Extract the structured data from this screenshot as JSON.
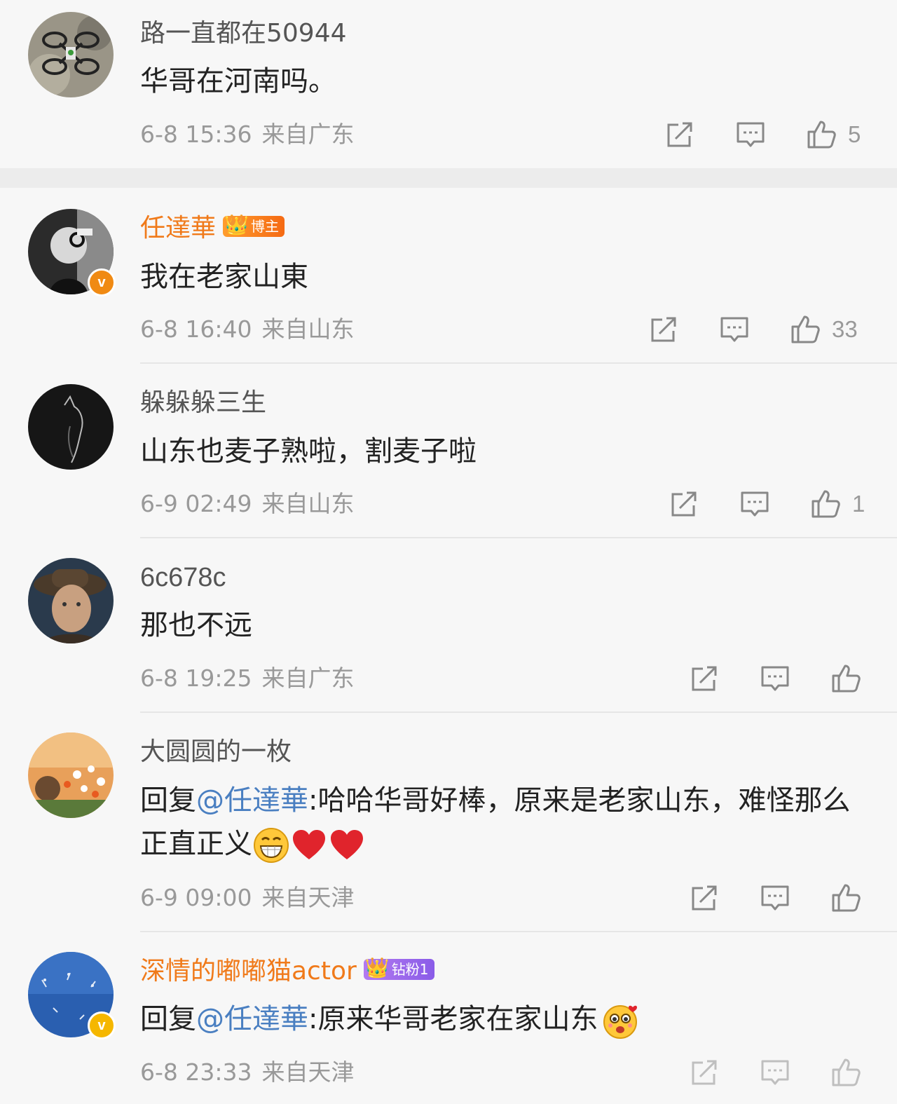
{
  "comments": [
    {
      "user": "路一直都在50944",
      "text": "华哥在河南吗。",
      "date": "6-8 15:36",
      "location": "来自广东",
      "likes": "5"
    },
    {
      "user": "任達華",
      "badge": "博主",
      "text": "我在老家山東",
      "date": "6-8 16:40",
      "location": "来自山东",
      "likes": "33"
    },
    {
      "user": "躲躲躲三生",
      "text": "山东也麦子熟啦，割麦子啦",
      "date": "6-9 02:49",
      "location": "来自山东",
      "likes": "1"
    },
    {
      "user": "6c678c",
      "text": "那也不远",
      "date": "6-8 19:25",
      "location": "来自广东",
      "likes": ""
    },
    {
      "user": "大圆圆的一枚",
      "reply_prefix": "回复",
      "mention": "@任達華",
      "text": ":哈哈华哥好棒，原来是老家山东，难怪那么正直正义",
      "emojis": [
        "grin",
        "heart",
        "heart"
      ],
      "date": "6-9 09:00",
      "location": "来自天津",
      "likes": ""
    },
    {
      "user": "深情的嘟嘟猫actor",
      "badge": "钻粉1",
      "reply_prefix": "回复",
      "mention": "@任達華",
      "text": ":原来华哥老家在家山东",
      "emojis": [
        "surprised"
      ],
      "date": "6-8 23:33",
      "location": "来自天津",
      "likes": ""
    }
  ],
  "icons": {
    "share": "share-icon",
    "comment": "comment-icon",
    "like": "thumbs-up-icon",
    "verified": "verified-v-icon"
  },
  "colors": {
    "username_highlight": "#f07a1a",
    "mention": "#4a7fc1",
    "meta": "#999999",
    "verified": "#f08a13"
  }
}
